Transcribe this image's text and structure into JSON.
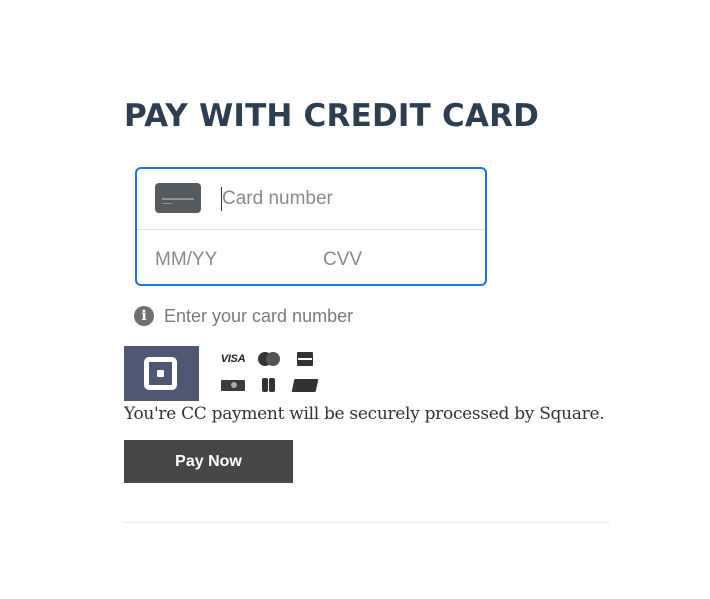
{
  "title": "PAY WITH CREDIT CARD",
  "form": {
    "card_number_placeholder": "Card number",
    "expiry_placeholder": "MM/YY",
    "cvv_placeholder": "CVV",
    "card_number_value": "",
    "expiry_value": "",
    "cvv_value": "",
    "focus_color": "#1b74e4"
  },
  "hint": {
    "icon": "info-icon",
    "text": "Enter your card number"
  },
  "logos": {
    "square": "square-logo",
    "card_brands": [
      "visa-logo",
      "mastercard-logo",
      "amex-logo",
      "discover-logo",
      "jcb-logo",
      "unionpay-logo"
    ],
    "visa_text": "VISA"
  },
  "secure_note": "You're CC payment will be securely processed by Square.",
  "pay_button": {
    "label": "Pay Now",
    "color": "#464646"
  },
  "colors": {
    "title": "#2c3e50",
    "square_bg": "#4e5873"
  }
}
